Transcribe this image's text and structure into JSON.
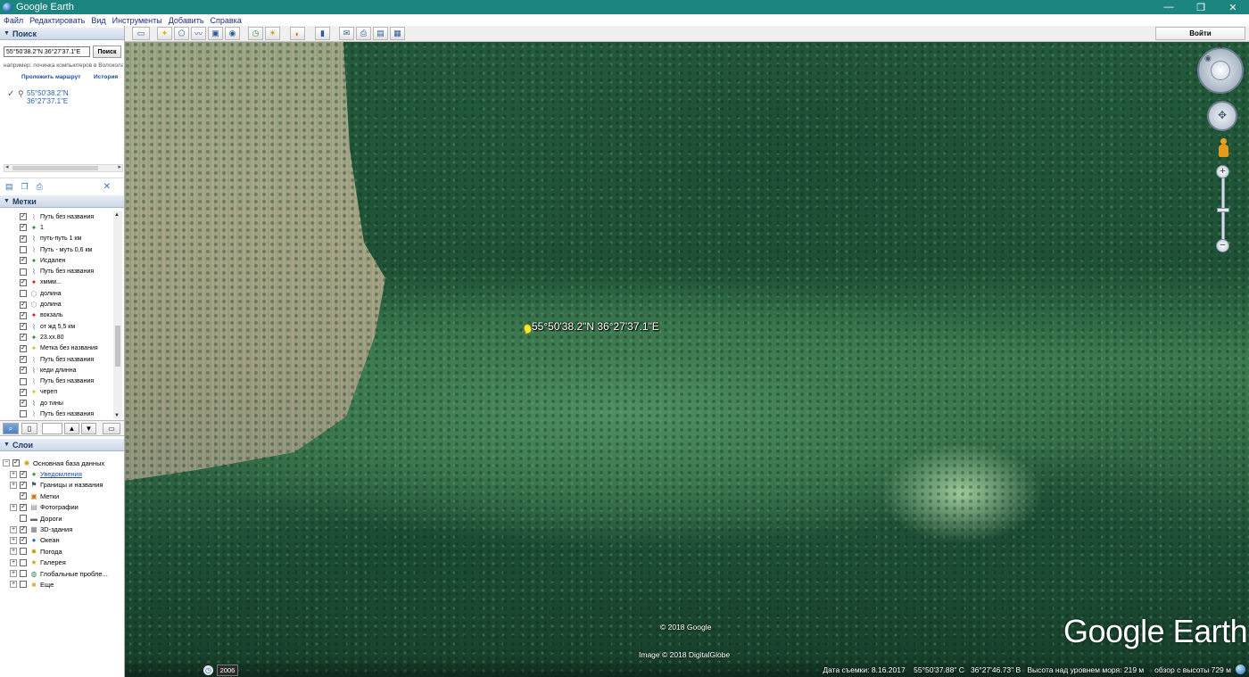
{
  "window": {
    "title": "Google Earth",
    "controls": {
      "minimize": "—",
      "maximize": "❐",
      "close": "✕"
    }
  },
  "menu": [
    "Файл",
    "Редактировать",
    "Вид",
    "Инструменты",
    "Добавить",
    "Справка"
  ],
  "toolbar": {
    "signin_label": "Войти"
  },
  "search": {
    "header": "Поиск",
    "input_value": "55°50'38.2\"N 36°27'37.1\"E",
    "button": "Поиск",
    "hint": "например: починка компьютеров в Волоколамске",
    "route_link": "Проложить маршрут",
    "history_link": "История",
    "result": {
      "line1": "55°50'38.2\"N",
      "line2": "36°27'37.1\"E"
    }
  },
  "places": {
    "header": "Метки",
    "items": [
      {
        "label": "Путь без названия",
        "checked": true,
        "icon": "path-icon",
        "color": "#8a8fa0"
      },
      {
        "label": "1",
        "checked": true,
        "icon": "pushpin-icon",
        "color": "#2b8a2b"
      },
      {
        "label": "путь-путь 1 км",
        "checked": true,
        "icon": "path-icon",
        "color": "#3a6fb0"
      },
      {
        "label": "Путь - муть 0,6 км",
        "checked": false,
        "icon": "path-icon",
        "color": "#8a8fa0"
      },
      {
        "label": "Исдален",
        "checked": true,
        "icon": "pushpin-icon",
        "color": "#2b8a2b"
      },
      {
        "label": "Путь без названия",
        "checked": false,
        "icon": "path-icon",
        "color": "#3a6fb0"
      },
      {
        "label": "хммм...",
        "checked": true,
        "icon": "pushpin-icon",
        "color": "#d02020"
      },
      {
        "label": "долина",
        "checked": false,
        "icon": "polygon-icon",
        "color": "#8a8fa0"
      },
      {
        "label": "долина",
        "checked": true,
        "icon": "polygon-icon",
        "color": "#8a8fa0"
      },
      {
        "label": "вокзаль",
        "checked": true,
        "icon": "pushpin-icon",
        "color": "#d02020"
      },
      {
        "label": "от жд 5,5 км",
        "checked": true,
        "icon": "path-icon",
        "color": "#3a6fb0"
      },
      {
        "label": "23.хх.80",
        "checked": true,
        "icon": "pushpin-icon",
        "color": "#2b8a2b"
      },
      {
        "label": "Метка без названия",
        "checked": true,
        "icon": "pushpin-icon",
        "color": "#d8c020"
      },
      {
        "label": "Путь без названия",
        "checked": true,
        "icon": "path-icon",
        "color": "#8a8fa0"
      },
      {
        "label": "кеди длинна",
        "checked": true,
        "icon": "path-icon",
        "color": "#3a6fb0"
      },
      {
        "label": "Путь без названия",
        "checked": false,
        "icon": "path-icon",
        "color": "#8a8fa0"
      },
      {
        "label": "череп",
        "checked": true,
        "icon": "pushpin-icon",
        "color": "#d8c020"
      },
      {
        "label": "до тины",
        "checked": true,
        "icon": "path-icon",
        "color": "#2b8a2b"
      },
      {
        "label": "Путь без названия",
        "checked": false,
        "icon": "path-icon",
        "color": "#8a8fa0"
      }
    ]
  },
  "layers": {
    "header": "Слои",
    "items": [
      {
        "label": "Основная база данных",
        "checked": true,
        "expander": "−",
        "icon": "database-icon",
        "link": false
      },
      {
        "label": "Уведомления",
        "checked": true,
        "expander": "+",
        "icon": "notification-icon",
        "link": true
      },
      {
        "label": "Границы и названия",
        "checked": true,
        "expander": "+",
        "icon": "borders-icon",
        "link": false
      },
      {
        "label": "Метки",
        "checked": true,
        "expander": "",
        "icon": "places-icon",
        "link": false
      },
      {
        "label": "Фотографии",
        "checked": true,
        "expander": "+",
        "icon": "photos-icon",
        "link": false
      },
      {
        "label": "Дороги",
        "checked": false,
        "expander": "",
        "icon": "roads-icon",
        "link": false
      },
      {
        "label": "3D-здания",
        "checked": true,
        "expander": "+",
        "icon": "buildings-icon",
        "link": false
      },
      {
        "label": "Океан",
        "checked": true,
        "expander": "+",
        "icon": "ocean-icon",
        "link": false
      },
      {
        "label": "Погода",
        "checked": false,
        "expander": "+",
        "icon": "weather-icon",
        "link": false
      },
      {
        "label": "Галерея",
        "checked": false,
        "expander": "+",
        "icon": "gallery-icon",
        "link": false
      },
      {
        "label": "Глобальные пробле...",
        "checked": false,
        "expander": "+",
        "icon": "global-icon",
        "link": false
      },
      {
        "label": "Еще",
        "checked": false,
        "expander": "+",
        "icon": "more-icon",
        "link": false
      }
    ]
  },
  "map": {
    "placemark_label": "55°50'38.2\"N 36°27'37.1\"E",
    "copyright": "© 2018 Google",
    "imagery": "Image © 2018 DigitalGlobe",
    "logo": "Google Earth",
    "history_year": "2006",
    "compass_north": "N"
  },
  "status": {
    "date": "Дата съемки: 8.16.2017",
    "lat": "55°50'37.88\" С",
    "lon": "36°27'46.73\" В",
    "elevation": "Высота над уровнем моря:  219 м",
    "eye_alt": "обзор с высоты  729 м"
  }
}
